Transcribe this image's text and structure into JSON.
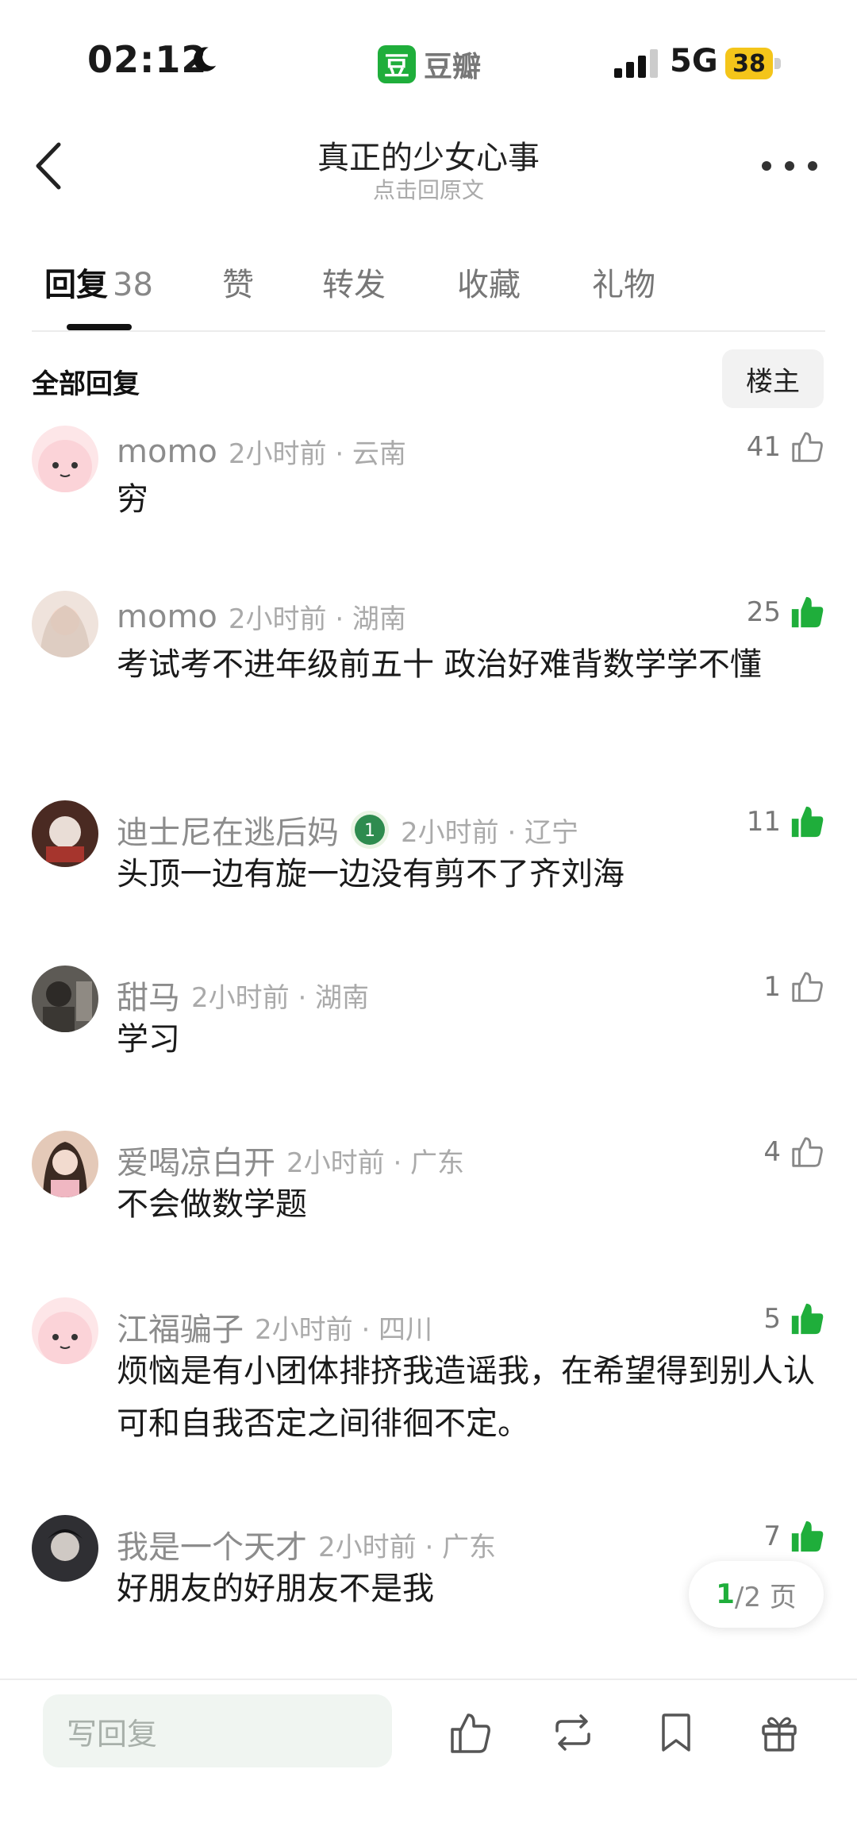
{
  "status_bar": {
    "time": "02:12",
    "app_logo": "豆",
    "app_name": "豆瓣",
    "network": "5G",
    "battery": "38"
  },
  "header": {
    "title": "真正的少女心事",
    "subtitle": "点击回原文"
  },
  "tabs": [
    {
      "label": "回复",
      "count": "38"
    },
    {
      "label": "赞"
    },
    {
      "label": "转发"
    },
    {
      "label": "收藏"
    },
    {
      "label": "礼物"
    }
  ],
  "filter": {
    "section_label": "全部回复",
    "op_button": "楼主"
  },
  "comments": [
    {
      "author": "momo",
      "time_loc": "2小时前 · 云南",
      "likes": "41",
      "liked": false,
      "text": "穷"
    },
    {
      "author": "momo",
      "time_loc": "2小时前 · 湖南",
      "likes": "25",
      "liked": true,
      "text": "考试考不进年级前五十 政治好难背数学学不懂"
    },
    {
      "author": "迪士尼在逃后妈",
      "time_loc": "2小时前 · 辽宁",
      "likes": "11",
      "liked": true,
      "badge": "1",
      "text": "头顶一边有旋一边没有剪不了齐刘海"
    },
    {
      "author": "甜马",
      "time_loc": "2小时前 · 湖南",
      "likes": "1",
      "liked": false,
      "text": "学习"
    },
    {
      "author": "爱喝凉白开",
      "time_loc": "2小时前 · 广东",
      "likes": "4",
      "liked": false,
      "text": "不会做数学题"
    },
    {
      "author": "江福骗子",
      "time_loc": "2小时前 · 四川",
      "likes": "5",
      "liked": true,
      "text": "烦恼是有小团体排挤我造谣我，在希望得到别人认可和自我否定之间徘徊不定。"
    },
    {
      "author": "我是一个天才",
      "time_loc": "2小时前 · 广东",
      "likes": "7",
      "liked": true,
      "text": "好朋友的好朋友不是我"
    }
  ],
  "pagination": {
    "current": "1",
    "rest": "/2 页"
  },
  "bottom_bar": {
    "reply_placeholder": "写回复"
  },
  "colors": {
    "accent": "#1fae3b",
    "battery": "#f4c51a"
  }
}
